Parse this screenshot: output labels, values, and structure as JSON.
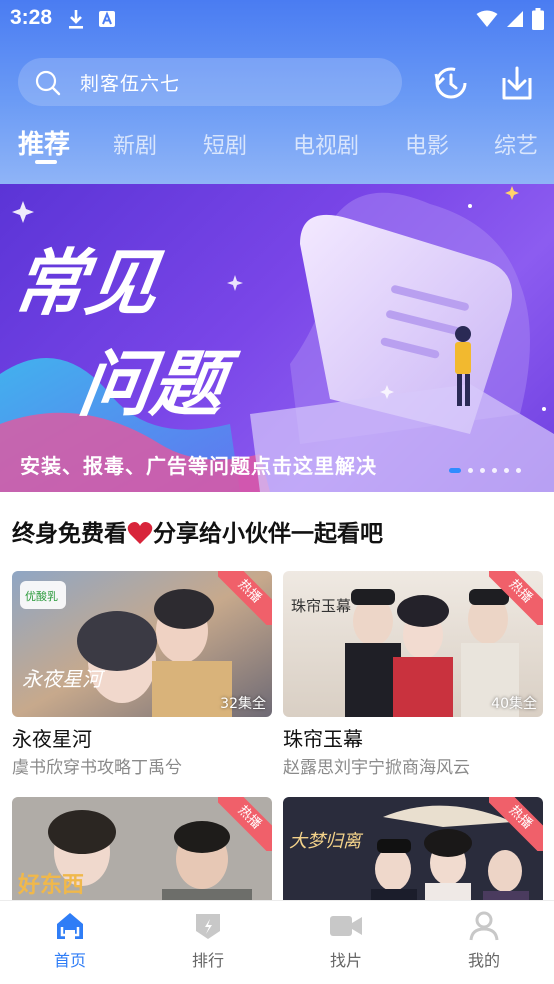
{
  "status_bar": {
    "time": "3:28"
  },
  "search": {
    "placeholder": "刺客伍六七"
  },
  "tabs": [
    {
      "label": "推荐",
      "active": true
    },
    {
      "label": "新剧",
      "active": false
    },
    {
      "label": "短剧",
      "active": false
    },
    {
      "label": "电视剧",
      "active": false
    },
    {
      "label": "电影",
      "active": false
    },
    {
      "label": "综艺",
      "active": false
    }
  ],
  "banner": {
    "title_line1": "常见",
    "title_line2": "问题",
    "caption": "安装、报毒、广告等问题点击这里解决",
    "slide_count": 6,
    "active_slide": 1
  },
  "section": {
    "title_before": "终身免费看",
    "title_after": "分享给小伙伴一起看吧"
  },
  "cards": [
    {
      "title": "永夜星河",
      "desc": "虞书欣穿书攻略丁禹兮",
      "badge": "热播",
      "episodes": "32集全",
      "poster_text": "永夜星河",
      "sticker": "优酸乳"
    },
    {
      "title": "珠帘玉幕",
      "desc": "赵露思刘宇宁掀商海风云",
      "badge": "热播",
      "episodes": "40集全",
      "poster_text": "珠帘玉幕"
    },
    {
      "title": "",
      "desc": "",
      "badge": "热播",
      "episodes": "",
      "poster_text": "好东西"
    },
    {
      "title": "",
      "desc": "",
      "badge": "热播",
      "episodes": "",
      "poster_text": "大梦归离"
    }
  ],
  "bottom_nav": [
    {
      "label": "首页",
      "icon": "home-icon",
      "active": true
    },
    {
      "label": "排行",
      "icon": "ranking-icon",
      "active": false
    },
    {
      "label": "找片",
      "icon": "video-camera-icon",
      "active": false
    },
    {
      "label": "我的",
      "icon": "user-icon",
      "active": false
    }
  ],
  "colors": {
    "header_blue": "#4a7cf2",
    "accent": "#2f7df6",
    "hot_badge": "#f0606a",
    "banner_purple": "#6f3fe0"
  }
}
